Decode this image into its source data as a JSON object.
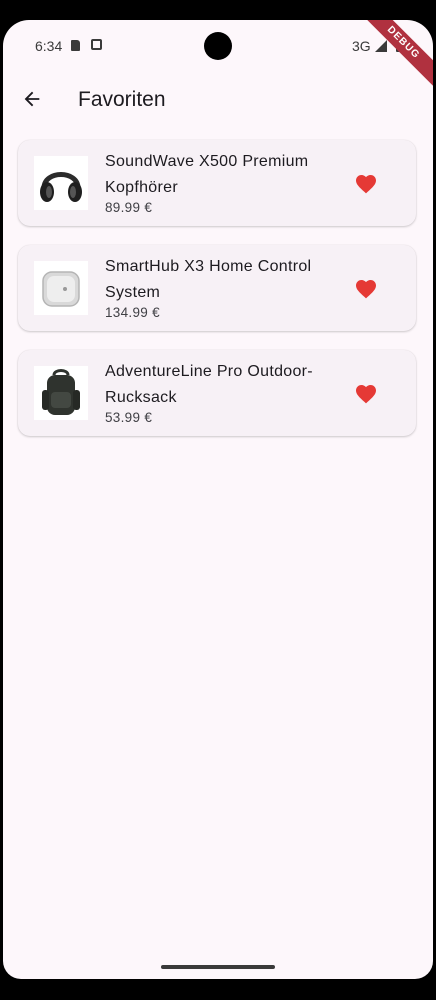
{
  "status_bar": {
    "time": "6:34",
    "network": "3G",
    "icons": [
      "sim-card-icon",
      "screenshot-icon",
      "signal-icon",
      "battery-icon"
    ]
  },
  "debug_banner": "DEBUG",
  "appbar": {
    "back_icon": "arrow-back-icon",
    "title": "Favoriten"
  },
  "favorites": [
    {
      "name": "SoundWave X500 Premium Kopfhörer",
      "price": "89.99 €",
      "image": "headphones",
      "favorite_icon": "heart-icon"
    },
    {
      "name": "SmartHub X3 Home Control System",
      "price": "134.99 €",
      "image": "smart-hub",
      "favorite_icon": "heart-icon"
    },
    {
      "name": "AdventureLine Pro Outdoor-Rucksack",
      "price": "53.99 €",
      "image": "backpack",
      "favorite_icon": "heart-icon"
    }
  ],
  "colors": {
    "background": "#fdf7fb",
    "card": "#f7f1f6",
    "heart": "#e53935",
    "debug_banner": "#b0313f"
  }
}
